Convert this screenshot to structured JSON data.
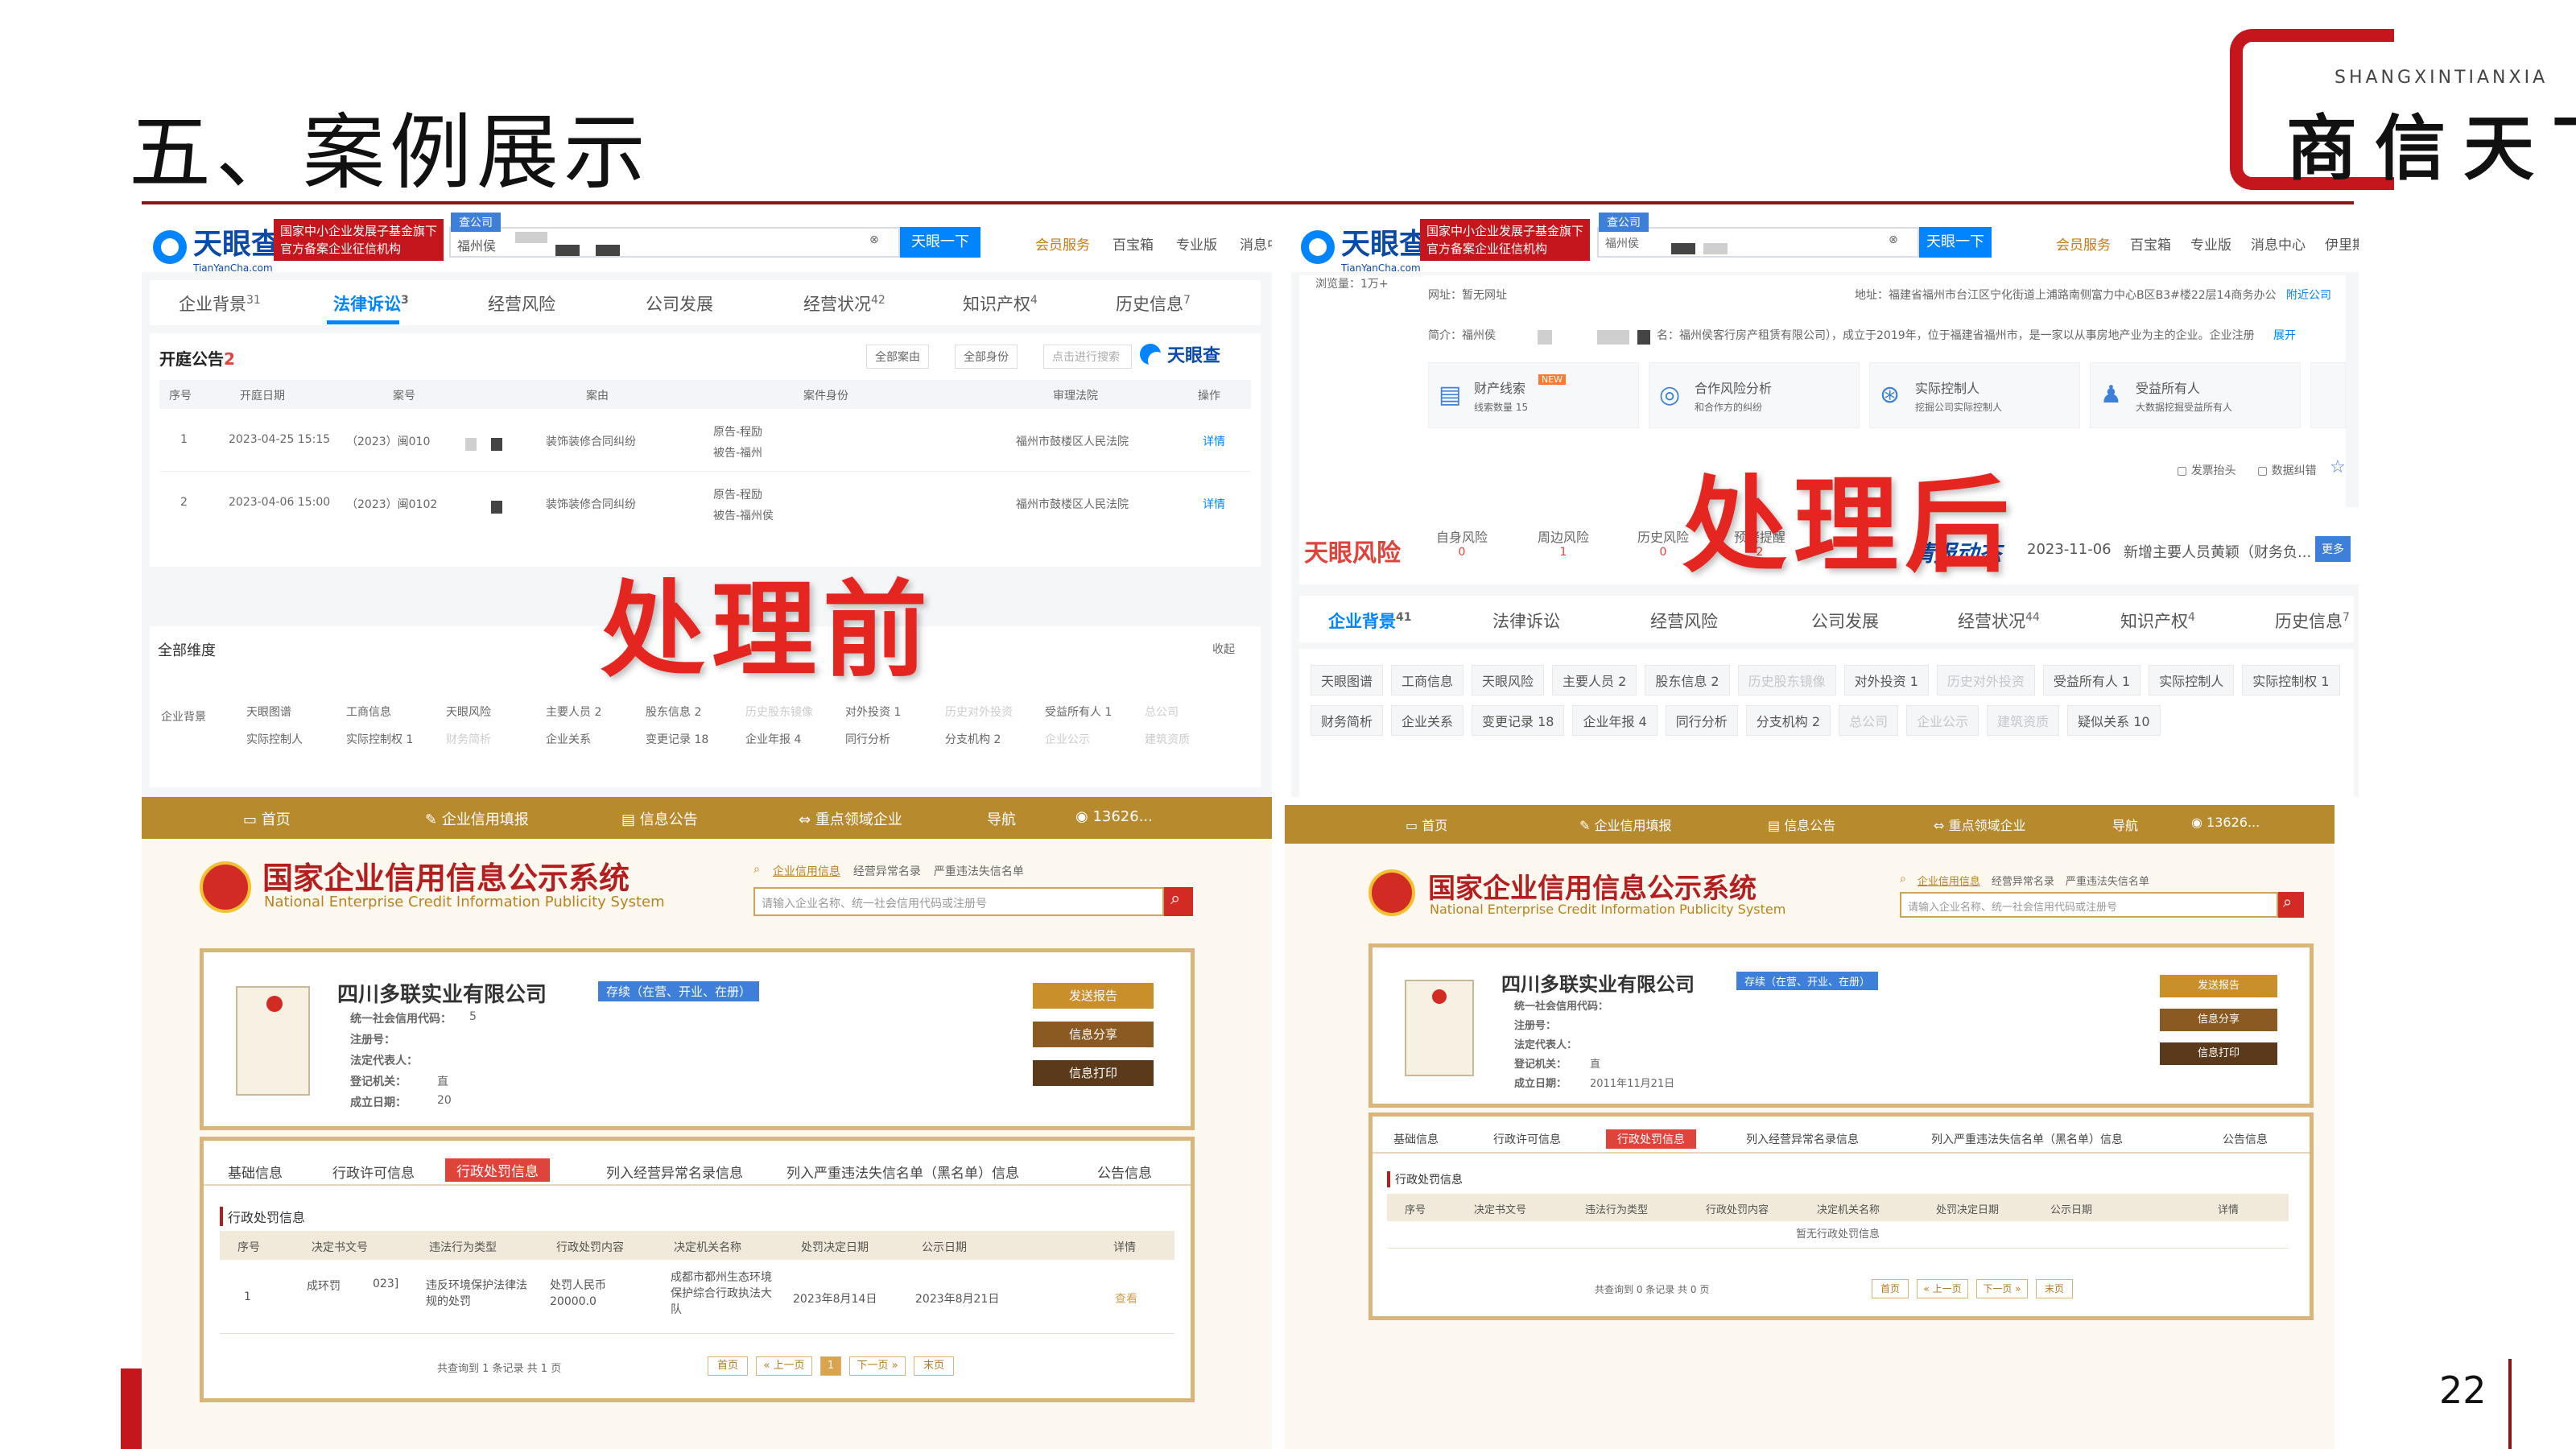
{
  "slide": {
    "title": "五、案例展示",
    "page_number": "22"
  },
  "logo": {
    "pinyin": "SHANGXINTIANXIA",
    "chars": "商信天下",
    "color": "#c4161c"
  },
  "labels": {
    "before": "处理前",
    "after": "处理后"
  },
  "tyc": {
    "brand": "天眼查",
    "domain": "TianYanCha.com",
    "banner_line1": "国家中小企业发展子基金旗下",
    "banner_line2": "官方备案企业征信机构",
    "search_tag": "查公司",
    "search_text": "福州侯",
    "search_button": "天眼一下",
    "nav": [
      "会员服务",
      "百宝箱",
      "专业版",
      "消息中心",
      "伊里斯"
    ],
    "tabs": [
      "企业背景",
      "法律诉讼",
      "经营风险",
      "公司发展",
      "经营状况",
      "知识产权",
      "历史信息"
    ],
    "tab_counts": [
      "31",
      "3",
      "",
      "",
      "42",
      "4",
      "7"
    ]
  },
  "before_tyc": {
    "section_title": "开庭公告",
    "section_count": "2",
    "filters": [
      "全部案由",
      "全部身份",
      "点击进行搜索"
    ],
    "columns": [
      "序号",
      "开庭日期",
      "案号",
      "案由",
      "案件身份",
      "审理法院",
      "操作"
    ],
    "rows": [
      {
        "no": "1",
        "date": "2023-04-25 15:15",
        "case": "（2023）闽010",
        "cause": "装饰装修合同纠纷",
        "role1": "原告-程励",
        "role2": "被告-福州",
        "court": "福州市鼓楼区人民法院",
        "op": "详情"
      },
      {
        "no": "2",
        "date": "2023-04-06 15:00",
        "case": "（2023）闽0102",
        "cause": "装饰装修合同纠纷",
        "role1": "原告-程励",
        "role2": "被告-福州侯",
        "court": "福州市鼓楼区人民法院",
        "op": "详情"
      }
    ],
    "dimension_title": "全部维度",
    "collapse": "收起",
    "dim_row_label": "企业背景",
    "dim_items": [
      "天眼图谱",
      "工商信息",
      "天眼风险",
      "主要人员 2",
      "股东信息 2",
      "历史股东镜像",
      "对外投资 1",
      "历史对外投资",
      "受益所有人 1",
      "实际控制人",
      "实际控制权 1",
      "财务简析",
      "企业关系",
      "变更记录 18",
      "企业年报 4",
      "同行分析",
      "分支机构 2",
      "总公司",
      "企业公示",
      "建筑资质"
    ]
  },
  "after_tyc": {
    "views": "浏览量：1万+",
    "website": "网址：暂无网址",
    "address": "地址：福建省福州市台江区宁化街道上浦路南侧富力中心B区B3#楼22层14商务办公",
    "nearby": "附近公司",
    "intro": "简介：福州侯",
    "intro_tail": "名：福州侯客行房产租赁有限公司），成立于2019年，位于福建省福州市，是一家以从事房地产业为主的企业。企业注册",
    "expand": "展开",
    "cards": [
      {
        "title": "财产线索",
        "sub": "线索数量 15",
        "badge": "NEW"
      },
      {
        "title": "合作风险分析",
        "sub": "和合作方的纠纷"
      },
      {
        "title": "实际控制人",
        "sub": "挖掘公司实际控制人"
      },
      {
        "title": "受益所有人",
        "sub": "大数据挖掘受益所有人"
      }
    ],
    "invoice": "发票抬头",
    "data_error": "数据纠错",
    "risk_brand": "天眼风险",
    "risk_items": [
      {
        "label": "自身风险",
        "count": "0"
      },
      {
        "label": "周边风险",
        "count": "1"
      },
      {
        "label": "历史风险",
        "count": "0"
      },
      {
        "label": "预警提醒",
        "count": "2"
      }
    ],
    "dynamic_title": "情报动态",
    "dynamic_date": "2023-11-06",
    "dynamic_text": "新增主要人员黄颖（财务负...",
    "more": "更多",
    "tab_counts": [
      "41",
      "",
      "",
      "",
      "44",
      "4",
      "7"
    ],
    "chips": [
      "天眼图谱",
      "工商信息",
      "天眼风险",
      "主要人员 2",
      "股东信息 2",
      "历史股东镜像",
      "对外投资 1",
      "历史对外投资",
      "受益所有人 1",
      "实际控制人",
      "实际控制权 1",
      "财务简析",
      "企业关系",
      "变更记录 18",
      "企业年报 4",
      "同行分析",
      "分支机构 2",
      "总公司",
      "企业公示",
      "建筑资质",
      "疑似关系 10"
    ],
    "faded": [
      5,
      7,
      17,
      18,
      19
    ]
  },
  "gsxt": {
    "nav": [
      "首页",
      "企业信用填报",
      "信息公告",
      "重点领域企业",
      "导航",
      "13626..."
    ],
    "title": "国家企业信用信息公示系统",
    "subtitle": "National Enterprise Credit Information Publicity System",
    "search_links": [
      "企业信用信息",
      "经营异常名录",
      "严重违法失信名单"
    ],
    "search_placeholder": "请输入企业名称、统一社会信用代码或注册号",
    "company": "四川多联实业有限公司",
    "status": "存续（在营、开业、在册）",
    "fields": [
      "统一社会信用代码：",
      "注册号：",
      "法定代表人：",
      "登记机关：",
      "成立日期："
    ],
    "buttons": [
      "发送报告",
      "信息分享",
      "信息打印"
    ],
    "tabs": [
      "基础信息",
      "行政许可信息",
      "行政处罚信息",
      "列入经营异常名录信息",
      "列入严重违法失信名单（黑名单）信息",
      "公告信息"
    ],
    "section": "行政处罚信息",
    "columns": [
      "序号",
      "决定书文号",
      "违法行为类型",
      "行政处罚内容",
      "决定机关名称",
      "处罚决定日期",
      "公示日期",
      "详情"
    ],
    "pager": [
      "首页",
      "« 上一页",
      "1",
      "下一页 »",
      "末页"
    ]
  },
  "before_gsxt": {
    "row": {
      "no": "1",
      "doc": "成环罚",
      "doc2": "023]",
      "type": "违反环境保护法律法规的处罚",
      "content": "处罚人民币20000.0",
      "org": "成都市都州生态环境保护综合行政执法大队",
      "decide": "2023年8月14日",
      "publish": "2023年8月21日",
      "detail": "查看"
    },
    "summary": "共查询到 1 条记录 共 1 页",
    "field_tail": [
      "5",
      "",
      "",
      "直",
      "20"
    ]
  },
  "after_gsxt": {
    "empty": "暂无行政处罚信息",
    "summary": "共查询到 0 条记录 共 0 页",
    "reg_org_tail": "直",
    "found_date": "2011年11月21日",
    "btn3": "信息打印"
  }
}
